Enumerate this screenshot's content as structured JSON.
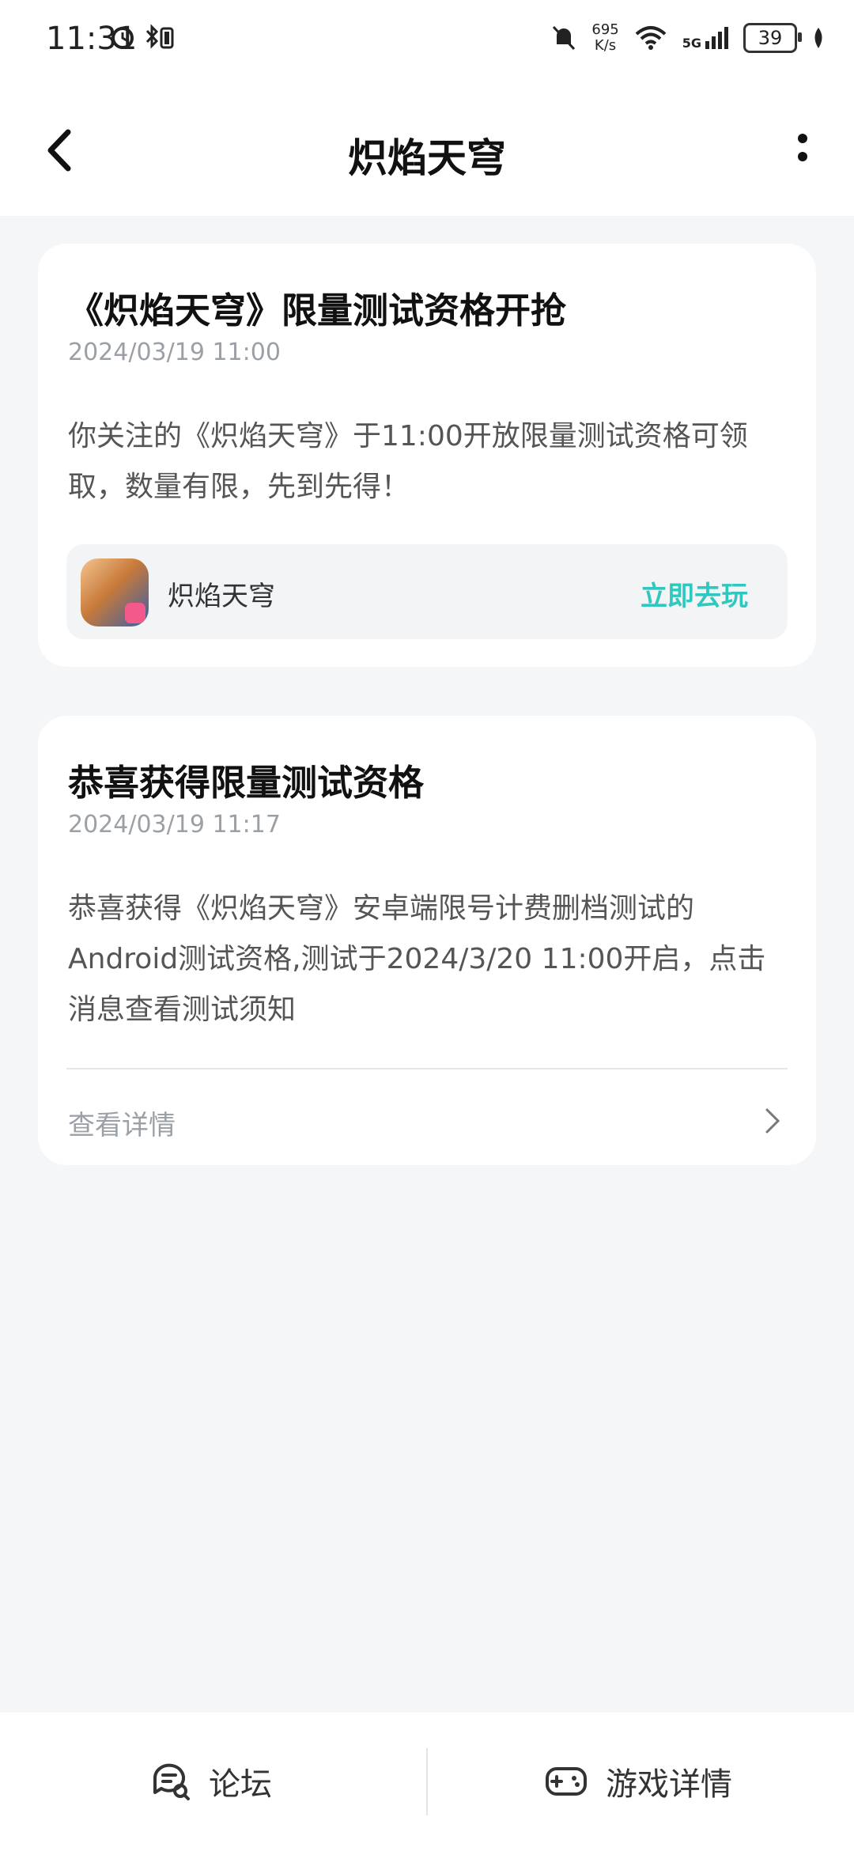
{
  "status_bar": {
    "time": "11:31",
    "net_speed_value": "695",
    "net_speed_unit": "K/s",
    "network": "5G",
    "battery": "39"
  },
  "header": {
    "title": "炽焰天穹"
  },
  "messages": [
    {
      "title": "《炽焰天穹》限量测试资格开抢",
      "time": "2024/03/19 11:00",
      "body": "你关注的《炽焰天穹》于11:00开放限量测试资格可领取，数量有限，先到先得！",
      "game_name": "炽焰天穹",
      "action_label": "立即去玩"
    },
    {
      "title": "恭喜获得限量测试资格",
      "time": "2024/03/19 11:17",
      "body": "恭喜获得《炽焰天穹》安卓端限号计费删档测试的Android测试资格,测试于2024/3/20 11:00开启，点击消息查看测试须知",
      "link_label": "查看详情"
    }
  ],
  "bottom_nav": {
    "forum_label": "论坛",
    "game_detail_label": "游戏详情"
  },
  "colors": {
    "accent": "#2FC7BE",
    "background": "#F5F6F8",
    "secondary_text": "#9AA0A6"
  }
}
